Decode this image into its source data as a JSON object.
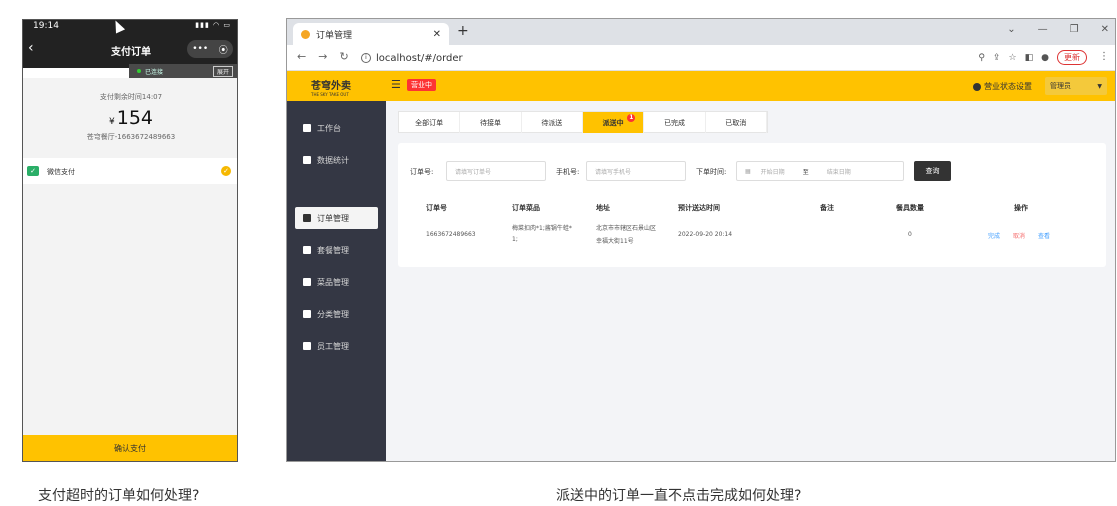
{
  "phone": {
    "status_time": "19:14",
    "nav_title": "支付订单",
    "capsule_more": "•••",
    "capsule_close": "⦿",
    "conn_status": "已连接",
    "conn_expand": "展开",
    "remaining_label": "支付剩余时间14:07",
    "currency": "¥",
    "amount": "154",
    "shop_order": "苍穹餐厅-1663672489663",
    "pay_method": "微信支付",
    "confirm_label": "确认支付"
  },
  "browser": {
    "tab_title": "订单管理",
    "url": "localhost/#/order",
    "update_label": "更新"
  },
  "app": {
    "logo": "苍穹外卖",
    "logo_sub": "THE SKY TAKE OUT",
    "open_status": "营业中",
    "shop_settings": "营业状态设置",
    "admin_label": "管理员"
  },
  "sidebar": {
    "items": [
      {
        "label": "工作台"
      },
      {
        "label": "数据统计"
      },
      {
        "label": "订单管理"
      },
      {
        "label": "套餐管理"
      },
      {
        "label": "菜品管理"
      },
      {
        "label": "分类管理"
      },
      {
        "label": "员工管理"
      }
    ]
  },
  "order_tabs": [
    {
      "label": "全部订单"
    },
    {
      "label": "待接单"
    },
    {
      "label": "待派送"
    },
    {
      "label": "派送中",
      "badge": "1"
    },
    {
      "label": "已完成"
    },
    {
      "label": "已取消"
    }
  ],
  "filters": {
    "order_no_label": "订单号:",
    "order_no_placeholder": "请填写订单号",
    "phone_label": "手机号:",
    "phone_placeholder": "请填写手机号",
    "time_label": "下单时间:",
    "start_placeholder": "开始日期",
    "range_sep": "至",
    "end_placeholder": "结束日期",
    "query_label": "查询"
  },
  "table": {
    "headers": [
      "订单号",
      "订单菜品",
      "地址",
      "预计送达时间",
      "备注",
      "餐具数量",
      "操作"
    ],
    "rows": [
      {
        "order_no": "1663672489663",
        "dishes_line1": "梅菜扣肉*1;酱锅牛蛙*",
        "dishes_line2": "1;",
        "address_line1": "北京市市辖区石景山区",
        "address_line2": "幸福大街11号",
        "eta": "2022-09-20 20:14",
        "note": "",
        "tableware": "0",
        "actions": [
          "完成",
          "取消",
          "查看"
        ]
      }
    ]
  },
  "captions": {
    "left": "支付超时的订单如何处理?",
    "right": "派送中的订单一直不点击完成如何处理?"
  }
}
